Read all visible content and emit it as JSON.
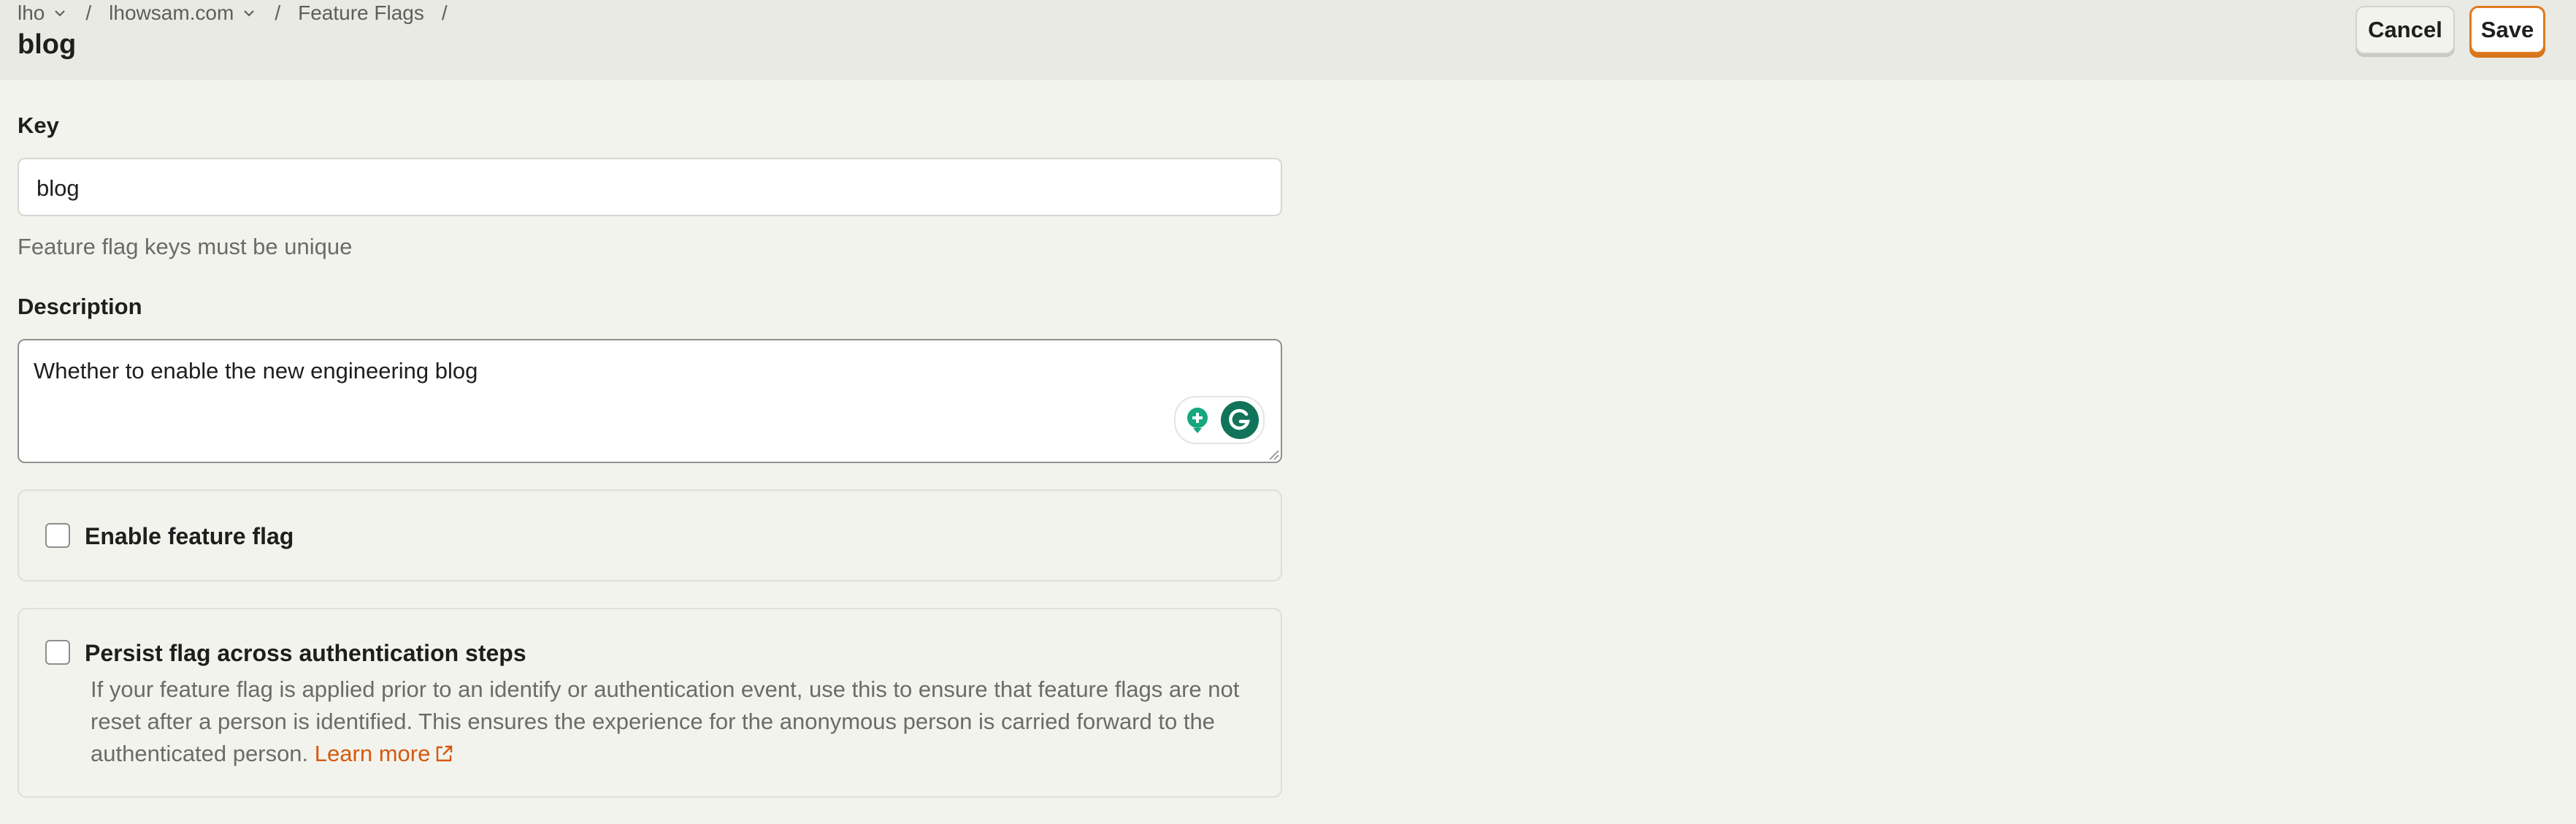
{
  "breadcrumb": {
    "items": [
      {
        "label": "lho",
        "dropdown": true
      },
      {
        "label": "lhowsam.com",
        "dropdown": true
      },
      {
        "label": "Feature Flags",
        "dropdown": false
      }
    ],
    "separator": "/"
  },
  "page": {
    "title": "blog"
  },
  "actions": {
    "cancel_label": "Cancel",
    "save_label": "Save"
  },
  "form": {
    "key": {
      "label": "Key",
      "value": "blog",
      "hint": "Feature flag keys must be unique"
    },
    "description": {
      "label": "Description",
      "value": "Whether to enable the new engineering blog"
    },
    "enable": {
      "label": "Enable feature flag",
      "checked": false
    },
    "persist": {
      "label": "Persist flag across authentication steps",
      "checked": false,
      "description": "If your feature flag is applied prior to an identify or authentication event, use this to ensure that feature flags are not reset after a person is identified. This ensures the experience for the anonymous person is carried forward to the authenticated person.",
      "link_label": "Learn more"
    }
  },
  "colors": {
    "accent": "#e07a1f",
    "link": "#d6590e",
    "grammarly": "#15a77d"
  },
  "icons": [
    "chevron-down-icon",
    "external-link-icon",
    "grammarly-suggestion-icon",
    "grammarly-logo-icon",
    "resize-handle-icon"
  ]
}
